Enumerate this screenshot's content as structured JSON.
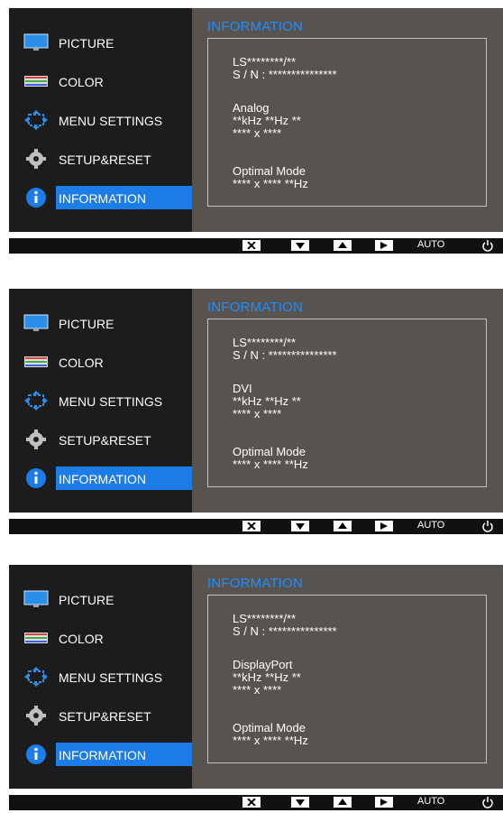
{
  "menu": {
    "title": "INFORMATION",
    "items": [
      {
        "label": "PICTURE",
        "icon": "monitor-icon"
      },
      {
        "label": "COLOR",
        "icon": "color-bars-icon"
      },
      {
        "label": "MENU SETTINGS",
        "icon": "menu-settings-arrows-icon"
      },
      {
        "label": "SETUP&RESET",
        "icon": "gear-icon"
      },
      {
        "label": "INFORMATION",
        "icon": "info-icon",
        "selected": true
      }
    ]
  },
  "screens": [
    {
      "model": "LS********/**",
      "serial": "S / N : ***************",
      "source": "Analog",
      "frequency": "**kHz **Hz **",
      "resolution": "**** x ****",
      "optimal_label": "Optimal Mode",
      "optimal_value": "**** x **** **Hz"
    },
    {
      "model": "LS********/**",
      "serial": "S / N : ***************",
      "source": "DVI",
      "frequency": "**kHz **Hz **",
      "resolution": "**** x ****",
      "optimal_label": "Optimal Mode",
      "optimal_value": "**** x **** **Hz"
    },
    {
      "model": "LS********/**",
      "serial": "S / N : ***************",
      "source": "DisplayPort",
      "frequency": "**kHz **Hz **",
      "resolution": "**** x ****",
      "optimal_label": "Optimal Mode",
      "optimal_value": "**** x **** **Hz"
    }
  ],
  "bottom_bar": {
    "buttons": [
      "close-icon",
      "down-arrow-icon",
      "up-arrow-icon",
      "right-arrow-icon"
    ],
    "auto_label": "AUTO",
    "power": "power-icon"
  },
  "colors": {
    "accent": "#1c7de8",
    "title_blue": "#1f8fff",
    "sidebar_bg": "#1c1c1c",
    "main_bg": "#58534f"
  }
}
